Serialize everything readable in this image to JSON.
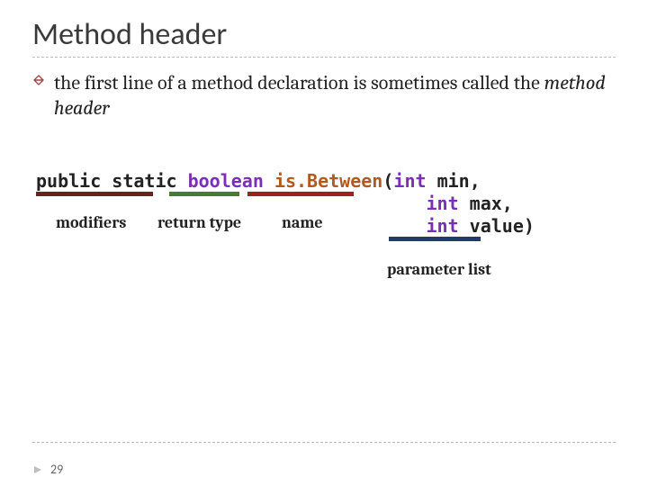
{
  "title": "Method header",
  "body": {
    "prefix": "the first line of a method declaration is sometimes called the ",
    "italic": "method header"
  },
  "code": {
    "modifiers": "public static",
    "return_type": "boolean",
    "fn_name": "is.Between",
    "paren_open": "(",
    "int_kw": "int",
    "p1": " min,",
    "p2": " max,",
    "p3": " value)",
    "indent": "                                    "
  },
  "annotations": {
    "modifiers": "modifiers",
    "return_type": "return type",
    "name": "name",
    "parameter_list": "parameter list"
  },
  "page_number": "29"
}
